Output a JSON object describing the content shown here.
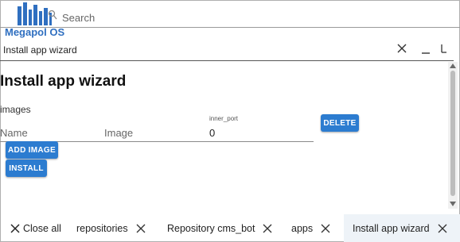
{
  "app": {
    "brand": "Megapol OS",
    "search_placeholder": "Search"
  },
  "window": {
    "title": "Install app wizard"
  },
  "wizard": {
    "heading": "Install app wizard",
    "section_label": "images",
    "fields": {
      "name_label": "Name",
      "image_label": "Image",
      "inner_port_label": "inner_port",
      "inner_port_value": "0"
    },
    "buttons": {
      "delete": "DELETE",
      "add_image": "ADD IMAGE",
      "install": "INSTALL"
    }
  },
  "taskbar": {
    "close_all": "Close all",
    "tabs": [
      {
        "label": "repositories",
        "active": false
      },
      {
        "label": "Repository cms_bot",
        "active": false
      },
      {
        "label": "apps",
        "active": false
      },
      {
        "label": "Install app wizard",
        "active": true
      }
    ]
  },
  "colors": {
    "accent": "#2c7cd0",
    "brand": "#2f6fc0",
    "active_tab_bg": "#eef3f8"
  },
  "icons": {
    "logo": "city-skyline-logo",
    "search": "search-icon",
    "close": "close-icon",
    "minimize": "minimize-icon",
    "maximize": "maximize-icon"
  }
}
